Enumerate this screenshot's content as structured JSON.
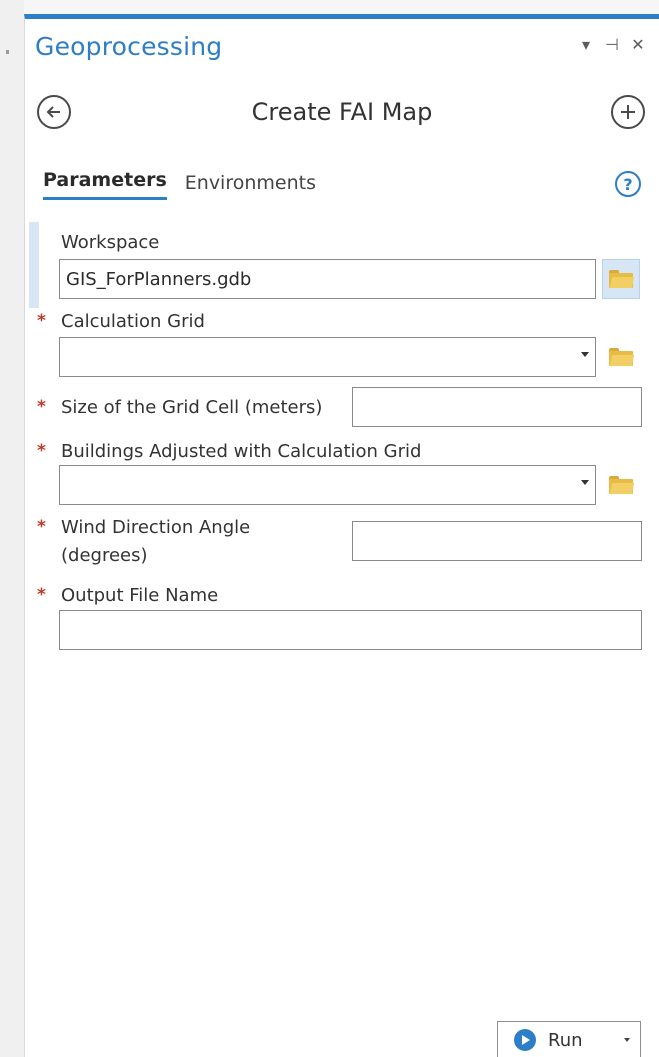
{
  "pane": {
    "title": "Geoprocessing",
    "controls": {
      "menu": "▾",
      "pin": "⊣",
      "close": "✕"
    }
  },
  "tool": {
    "title": "Create FAI Map",
    "back_icon": "arrow-left-circle-icon",
    "add_icon": "plus-circle-icon"
  },
  "tabs": [
    {
      "label": "Parameters",
      "active": true
    },
    {
      "label": "Environments",
      "active": false
    }
  ],
  "help": {
    "glyph": "?"
  },
  "parameters": [
    {
      "label": "Workspace",
      "value": "GIS_ForPlanners.gdb",
      "required": false
    },
    {
      "label": "Calculation Grid",
      "value": "",
      "required": true
    },
    {
      "label": "Size of the Grid Cell (meters)",
      "value": "",
      "required": true
    },
    {
      "label": "Buildings Adjusted with Calculation Grid",
      "value": "",
      "required": true
    },
    {
      "label_line1": "Wind Direction Angle",
      "label_line2": "(degrees)",
      "value": "",
      "required": true
    },
    {
      "label": "Output File Name",
      "value": "",
      "required": true
    }
  ],
  "required_marker": "*",
  "run": {
    "label": "Run"
  },
  "colors": {
    "accent": "#2d7ec6",
    "required": "#c0392b",
    "folder": "#e8bb45"
  }
}
